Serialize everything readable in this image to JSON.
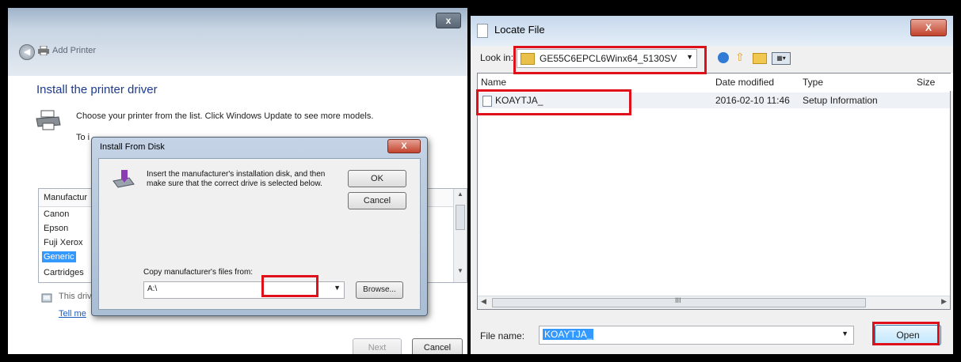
{
  "colors": {
    "highlight": "#e0101a",
    "selection": "#3399ff",
    "heading": "#1c3b8f"
  },
  "add_printer": {
    "close_label": "x",
    "title": "Add Printer",
    "heading": "Install the printer driver",
    "choose_text": "Choose your printer from the list. Click Windows Update to see more models.",
    "to_text": "To i",
    "manufacturer_header": "Manufactur",
    "manufacturers": [
      "Canon",
      "Epson",
      "Fuji Xerox",
      "Generic",
      "Cartridges"
    ],
    "this_driver": "This driv",
    "tell_me": "Tell me",
    "next_label": "Next",
    "cancel_label": "Cancel"
  },
  "install_from_disk": {
    "title": "Install From Disk",
    "close_label": "X",
    "message": "Insert the manufacturer's installation disk, and then make sure that the correct drive is selected below.",
    "ok_label": "OK",
    "cancel_label": "Cancel",
    "copy_label": "Copy manufacturer's files from:",
    "copy_value": "A:\\",
    "browse_label": "Browse..."
  },
  "locate_file": {
    "title": "Locate File",
    "close_label": "X",
    "look_in_label": "Look in:",
    "look_in_value": "GE55C6EPCL6Winx64_5130SV",
    "columns": [
      "Name",
      "Date modified",
      "Type",
      "Size"
    ],
    "files": [
      {
        "name": "KOAYTJA_",
        "date": "2016-02-10 11:46",
        "type": "Setup Information"
      }
    ],
    "file_name_label": "File name:",
    "file_name_value": "KOAYTJA_",
    "open_label": "Open",
    "scroll_grip": "III"
  },
  "icons": [
    "back-arrow-icon",
    "printer-icon",
    "shield-icon",
    "disk-drive-icon",
    "folder-icon",
    "back-nav-icon",
    "up-folder-icon",
    "new-folder-icon",
    "view-menu-icon",
    "file-icon",
    "dropdown-arrow-icon"
  ]
}
